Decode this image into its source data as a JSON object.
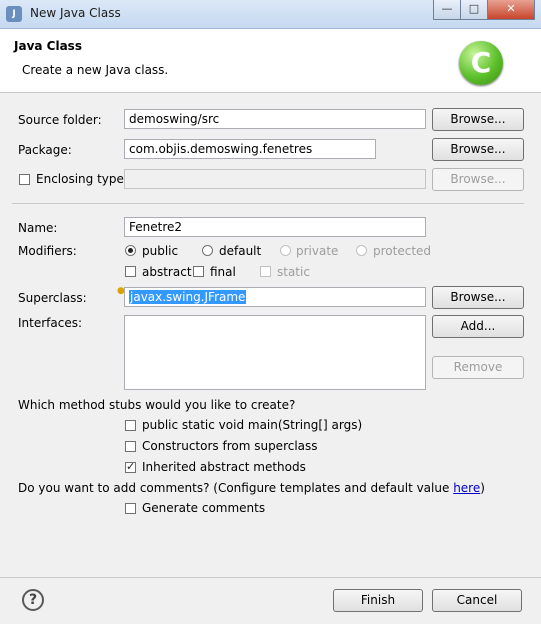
{
  "window": {
    "title": "New Java Class",
    "app_icon_glyph": "J"
  },
  "header": {
    "title": "Java Class",
    "subtitle": "Create a new Java class.",
    "logo_glyph": "C"
  },
  "form": {
    "source_folder": {
      "label": "Source folder:",
      "value": "demoswing/src",
      "browse": "Browse..."
    },
    "package": {
      "label": "Package:",
      "value": "com.objis.demoswing.fenetres",
      "browse": "Browse..."
    },
    "enclosing_type": {
      "label": "Enclosing type:",
      "value": "",
      "browse": "Browse...",
      "checked": false
    },
    "name": {
      "label": "Name:",
      "value": "Fenetre2"
    },
    "modifiers": {
      "label": "Modifiers:",
      "public": "public",
      "default": "default",
      "private": "private",
      "protected": "protected",
      "abstract": "abstract",
      "final": "final",
      "static": "static"
    },
    "superclass": {
      "label": "Superclass:",
      "value": "javax.swing.JFrame",
      "browse": "Browse..."
    },
    "interfaces": {
      "label": "Interfaces:",
      "add": "Add...",
      "remove": "Remove"
    },
    "stubs": {
      "question": "Which method stubs would you like to create?",
      "main": "public static void main(String[] args)",
      "constructors": "Constructors from superclass",
      "inherited": "Inherited abstract methods"
    },
    "comments": {
      "question": "Do you want to add comments? (Configure templates and default value ",
      "link": "here",
      "question_end": ")",
      "generate": "Generate comments"
    }
  },
  "footer": {
    "help_glyph": "?",
    "finish": "Finish",
    "cancel": "Cancel"
  },
  "titlebar_buttons": {
    "minimize": "—",
    "maximize": "□",
    "close": "✕"
  },
  "colors": {
    "selection": "#3399ff",
    "link": "#0000cc",
    "logo_green": "#5cbf2a"
  }
}
